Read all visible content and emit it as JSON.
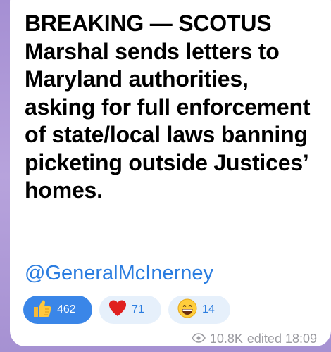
{
  "post": {
    "lines": [
      "BREAKING — SCOTUS",
      "Marshal sends letters to",
      "Maryland authorities,",
      "asking for full enforcement",
      "of state/local laws banning",
      "picketing outside Justices’",
      "homes."
    ],
    "mention": "@GeneralMcInerney"
  },
  "reactions": [
    {
      "icon": "thumbs-up-icon",
      "count": "462",
      "selected": true
    },
    {
      "icon": "heart-icon",
      "count": "71",
      "selected": false
    },
    {
      "icon": "grinning-face-icon",
      "count": "14",
      "selected": false
    }
  ],
  "meta": {
    "views_icon": "eye-icon",
    "views": "10.8K",
    "edited_time": "edited 18:09"
  },
  "colors": {
    "accent": "#3a86e8",
    "link": "#2b7de0",
    "reaction_bg": "#e6f0fb",
    "meta_text": "#9a9aa0"
  }
}
